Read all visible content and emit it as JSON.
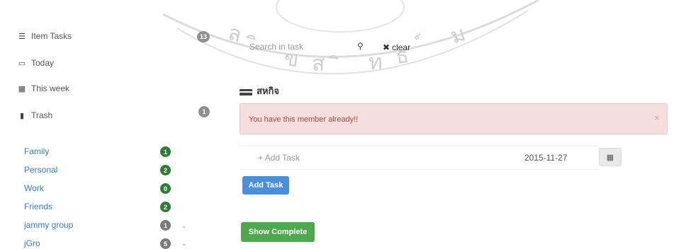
{
  "sidebar": {
    "nav": [
      {
        "label": "Item Tasks",
        "icon": "list-icon",
        "badge": "13"
      },
      {
        "label": "Today",
        "icon": "calendar-icon"
      },
      {
        "label": "This week",
        "icon": "calendar-week-icon"
      },
      {
        "label": "Trash",
        "icon": "trash-icon",
        "badge": "1"
      }
    ],
    "categories": [
      {
        "label": "Family",
        "badge": "1"
      },
      {
        "label": "Personal",
        "badge": "2"
      },
      {
        "label": "Work",
        "badge": "0"
      },
      {
        "label": "Friends",
        "badge": "2"
      },
      {
        "label": "jammy group",
        "badge": "1"
      },
      {
        "label": "jGro",
        "badge": "5"
      }
    ]
  },
  "search": {
    "placeholder": "Search in task",
    "clear_label": "clear"
  },
  "main": {
    "section_title": "สหกิจ",
    "alert_text": "You have this member already!!",
    "task_placeholder": "+ Add Task",
    "date_value": "2015-11-27",
    "add_task_label": "Add Task",
    "show_complete_label": "Show Complete"
  },
  "watermark": {
    "text": "ลิขสิทธิ์มหาวิทยาลัยเชียงใหม่"
  },
  "colors": {
    "link": "#3a7bc8",
    "badge_green": "#2e7d32",
    "primary": "#4a8fd9",
    "success": "#4ea84e",
    "alert_bg": "#f5dede",
    "alert_text": "#a94442"
  }
}
